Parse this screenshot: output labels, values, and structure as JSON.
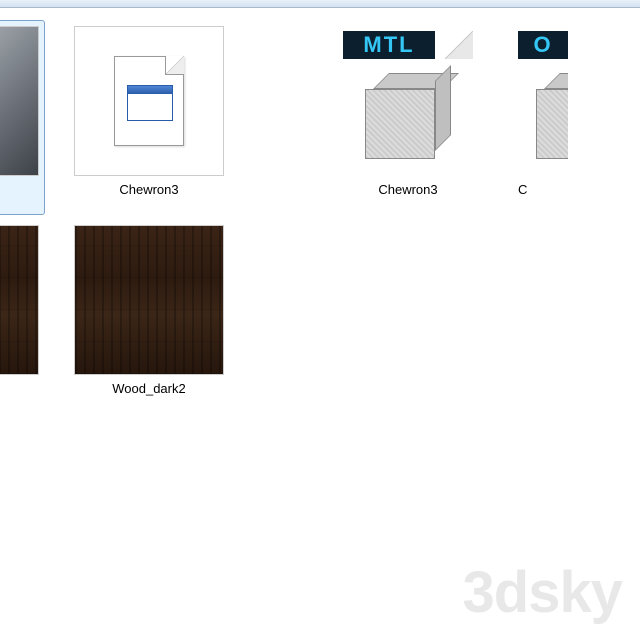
{
  "files": {
    "row1": {
      "item1": {
        "label": "",
        "type": "image"
      },
      "item2": {
        "label": "Chewron3",
        "type": "app"
      },
      "item3": {
        "label": "Chewron3",
        "type": "mtl",
        "banner": "MTL"
      },
      "item4": {
        "label": "C",
        "type": "obj",
        "banner": "O"
      }
    },
    "row2": {
      "item1": {
        "label": "",
        "type": "wood"
      },
      "item2": {
        "label": "Wood_dark2",
        "type": "wood"
      }
    }
  },
  "watermark": "3dsky"
}
